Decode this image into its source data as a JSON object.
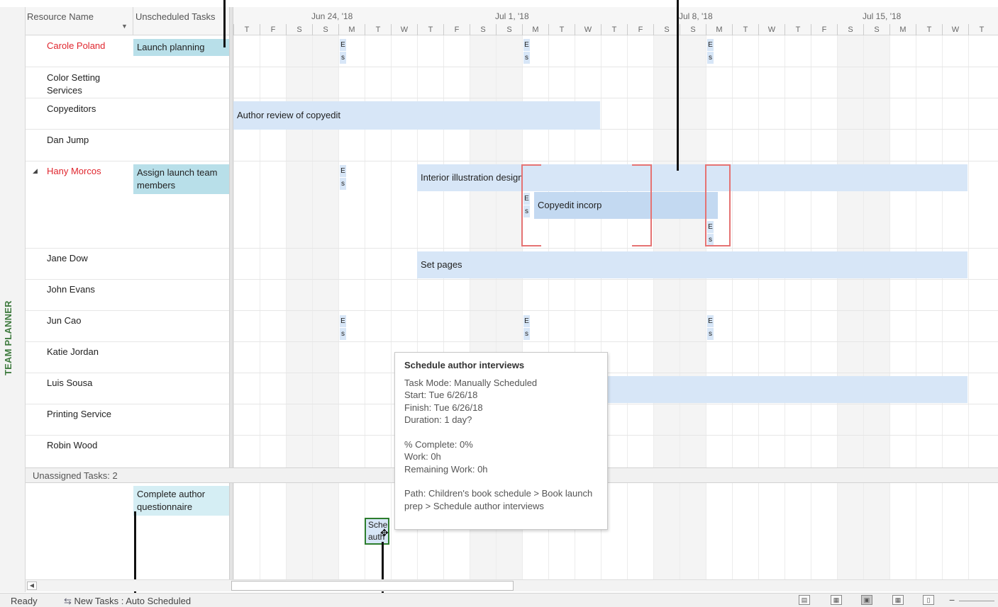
{
  "view_label": "TEAM PLANNER",
  "header": {
    "resource_name": "Resource Name",
    "unscheduled_tasks": "Unscheduled Tasks",
    "weeks": [
      "Jun 24, '18",
      "Jul 1, '18",
      "Jul 8, '18",
      "Jul 15, '18"
    ],
    "days": [
      "T",
      "F",
      "S",
      "S",
      "M",
      "T",
      "W",
      "T",
      "F",
      "S",
      "S",
      "M",
      "T",
      "W",
      "T",
      "F",
      "S",
      "S",
      "M",
      "T",
      "W",
      "T",
      "F",
      "S",
      "S",
      "M",
      "T",
      "W",
      "T"
    ]
  },
  "resources": [
    {
      "name": "Carole Poland",
      "unscheduled": "Launch planning"
    },
    {
      "name": "Color Setting Services"
    },
    {
      "name": "Copyeditors"
    },
    {
      "name": "Dan Jump"
    },
    {
      "name": "Hany Morcos",
      "unscheduled": "Assign launch team members"
    },
    {
      "name": "Jane Dow"
    },
    {
      "name": "John Evans"
    },
    {
      "name": "Jun Cao"
    },
    {
      "name": "Katie Jordan"
    },
    {
      "name": "Luis Sousa"
    },
    {
      "name": "Printing Service"
    },
    {
      "name": "Robin Wood"
    }
  ],
  "tasks": {
    "author_review": "Author review of copyedit",
    "interior_illustration": "Interior illustration design",
    "copyedit_incorp": "Copyedit incorp",
    "set_pages": "Set pages",
    "es_top": "E",
    "es_bottom": "s"
  },
  "unassigned": {
    "label": "Unassigned Tasks: 2",
    "unscheduled": "Complete author questionnaire",
    "drag_task": "Sche auth"
  },
  "tooltip": {
    "title": "Schedule author interviews",
    "task_mode": "Task Mode: Manually Scheduled",
    "start": "Start: Tue 6/26/18",
    "finish": "Finish: Tue 6/26/18",
    "duration": "Duration: 1 day?",
    "complete": "% Complete: 0%",
    "work": "Work: 0h",
    "remaining": "Remaining Work: 0h",
    "path": "Path: Children's book schedule > Book launch prep > Schedule author interviews"
  },
  "statusbar": {
    "ready": "Ready",
    "new_tasks": "New Tasks : Auto Scheduled"
  },
  "colors": {
    "overallocated": "#e0262e",
    "bar": "#d7e6f7",
    "unscheduled": "#b8dfe9",
    "view_label": "#3f7b3f"
  }
}
